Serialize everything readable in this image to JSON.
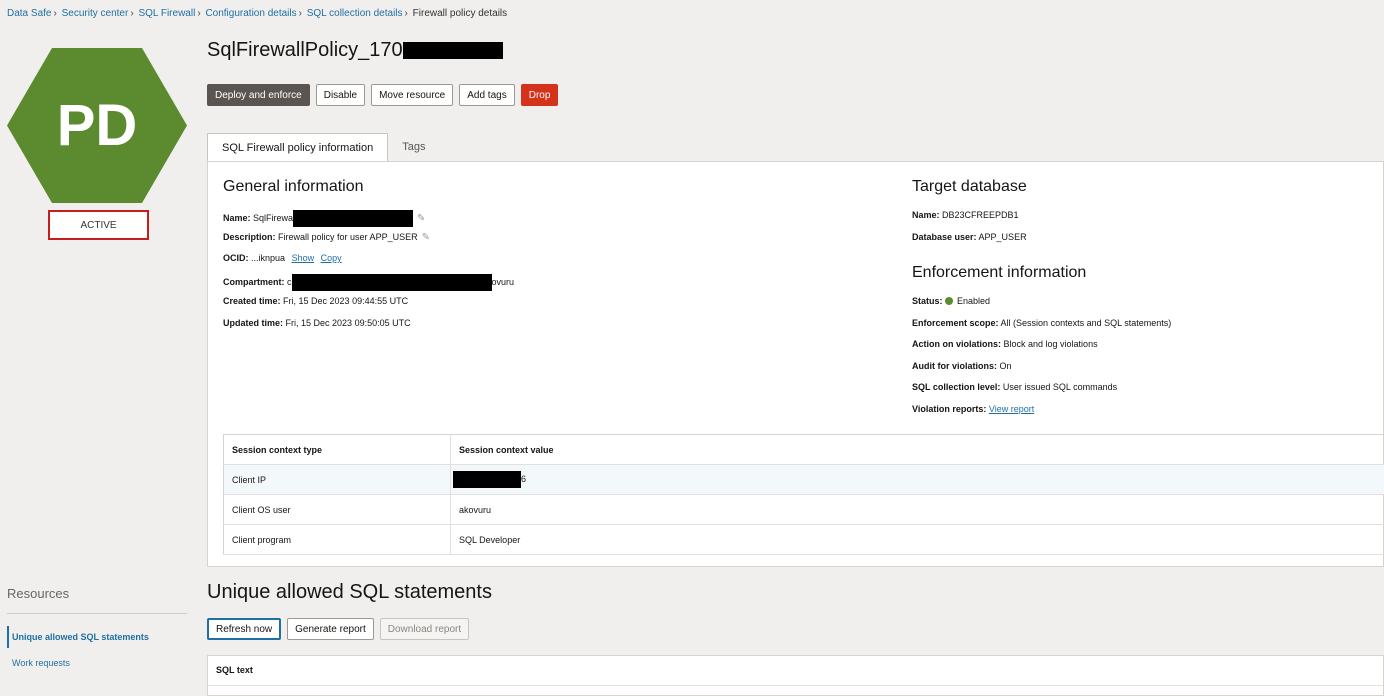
{
  "breadcrumb": {
    "items": [
      "Data Safe",
      "Security center",
      "SQL Firewall",
      "Configuration details",
      "SQL collection details"
    ],
    "current": "Firewall policy details",
    "separator": "›"
  },
  "resource_icon": {
    "initials": "PD",
    "color": "#5c8a2e",
    "status": "ACTIVE"
  },
  "page": {
    "title": "SqlFirewallPolicy_170"
  },
  "actions": {
    "deploy": "Deploy and enforce",
    "disable": "Disable",
    "move": "Move resource",
    "add_tags": "Add tags",
    "drop": "Drop"
  },
  "tabs": {
    "info": "SQL Firewall policy information",
    "tags": "Tags"
  },
  "general": {
    "heading": "General information",
    "name_label": "Name:",
    "name_value": "SqlFirewa",
    "desc_label": "Description:",
    "desc_value": "Firewall policy for user APP_USER",
    "ocid_label": "OCID:",
    "ocid_value": "...iknpua",
    "ocid_show": "Show",
    "ocid_copy": "Copy",
    "compartment_label": "Compartment:",
    "compartment_prefix": "c",
    "compartment_suffix": "ovuru",
    "created_label": "Created time:",
    "created_value": "Fri, 15 Dec 2023 09:44:55 UTC",
    "updated_label": "Updated time:",
    "updated_value": "Fri, 15 Dec 2023 09:50:05 UTC"
  },
  "target": {
    "heading": "Target database",
    "name_label": "Name:",
    "name_value": "DB23CFREEPDB1",
    "user_label": "Database user:",
    "user_value": "APP_USER"
  },
  "enforcement": {
    "heading": "Enforcement information",
    "status_label": "Status:",
    "status_value": "Enabled",
    "scope_label": "Enforcement scope:",
    "scope_value": "All (Session contexts and SQL statements)",
    "action_label": "Action on violations:",
    "action_value": "Block and log violations",
    "audit_label": "Audit for violations:",
    "audit_value": "On",
    "level_label": "SQL collection level:",
    "level_value": "User issued SQL commands",
    "reports_label": "Violation reports:",
    "reports_link": "View report"
  },
  "context_table": {
    "col1": "Session context type",
    "col2": "Session context value",
    "rows": [
      {
        "type": "Client IP",
        "value": "6"
      },
      {
        "type": "Client OS user",
        "value": "akovuru"
      },
      {
        "type": "Client program",
        "value": "SQL Developer"
      }
    ]
  },
  "resources": {
    "heading": "Resources",
    "items": [
      "Unique allowed SQL statements",
      "Work requests"
    ]
  },
  "sql_section": {
    "heading": "Unique allowed SQL statements",
    "refresh": "Refresh now",
    "generate": "Generate report",
    "download": "Download report",
    "col_sql": "SQL text"
  }
}
